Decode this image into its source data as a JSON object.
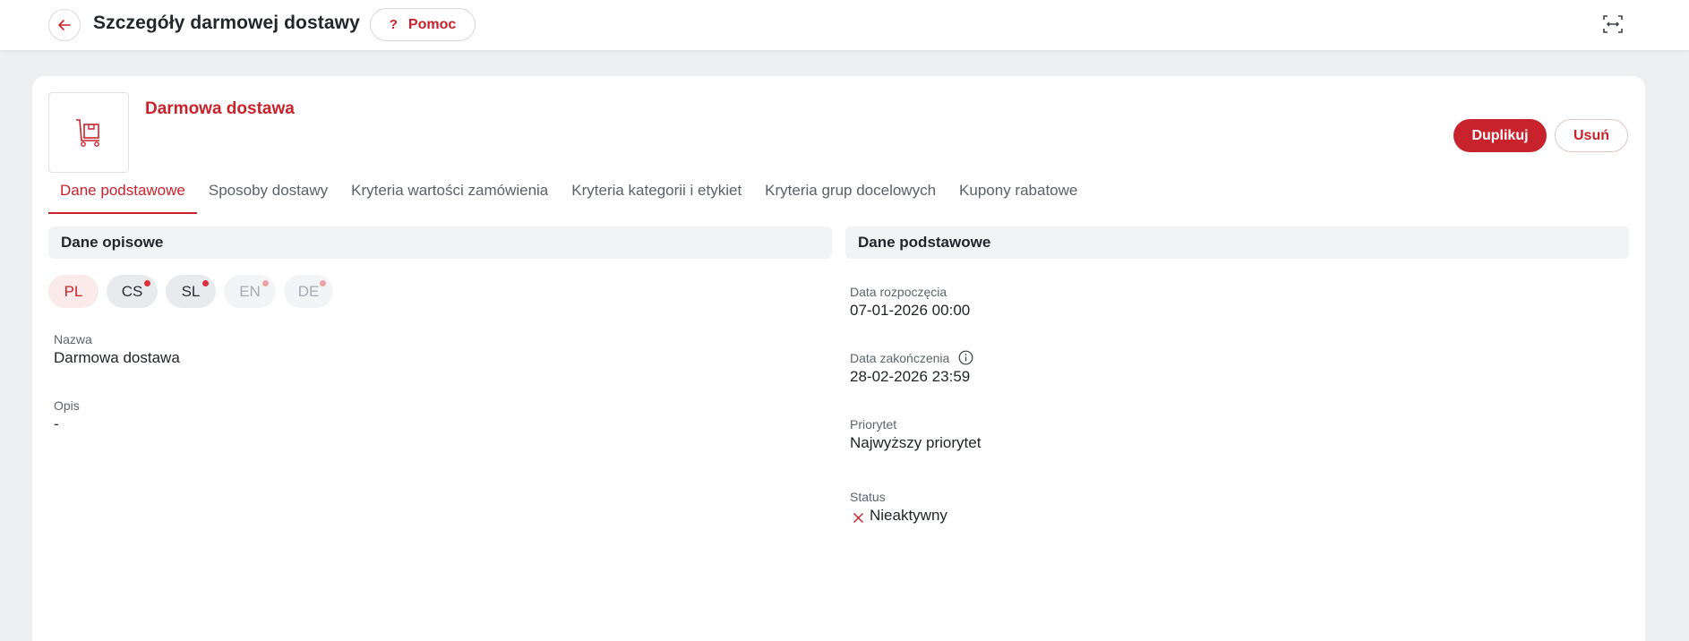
{
  "header": {
    "title": "Szczegóły darmowej dostawy",
    "help_label": "Pomoc",
    "help_icon": "?"
  },
  "entity": {
    "name": "Darmowa dostawa",
    "icon": "delivery-cart-icon"
  },
  "actions": {
    "duplicate_label": "Duplikuj",
    "delete_label": "Usuń"
  },
  "tabs": [
    {
      "label": "Dane podstawowe",
      "active": true
    },
    {
      "label": "Sposoby dostawy",
      "active": false
    },
    {
      "label": "Kryteria wartości zamówienia",
      "active": false
    },
    {
      "label": "Kryteria kategorii i etykiet",
      "active": false
    },
    {
      "label": "Kryteria grup docelowych",
      "active": false
    },
    {
      "label": "Kupony rabatowe",
      "active": false
    }
  ],
  "descriptive": {
    "title": "Dane opisowe",
    "languages": [
      {
        "code": "PL",
        "state": "active"
      },
      {
        "code": "CS",
        "state": "missing"
      },
      {
        "code": "SL",
        "state": "missing"
      },
      {
        "code": "EN",
        "state": "disabled"
      },
      {
        "code": "DE",
        "state": "disabled"
      }
    ],
    "name_label": "Nazwa",
    "name_value": "Darmowa dostawa",
    "description_label": "Opis",
    "description_value": "-"
  },
  "basic": {
    "title": "Dane podstawowe",
    "start_label": "Data rozpoczęcia",
    "start_value": "07-01-2026 00:00",
    "end_label": "Data zakończenia",
    "end_value": "28-02-2026 23:59",
    "priority_label": "Priorytet",
    "priority_value": "Najwyższy priorytet",
    "status_label": "Status",
    "status_value": "Nieaktywny"
  },
  "colors": {
    "accent": "#c8232c",
    "background": "#eeeff1",
    "panel_header": "#f2f3f5"
  }
}
